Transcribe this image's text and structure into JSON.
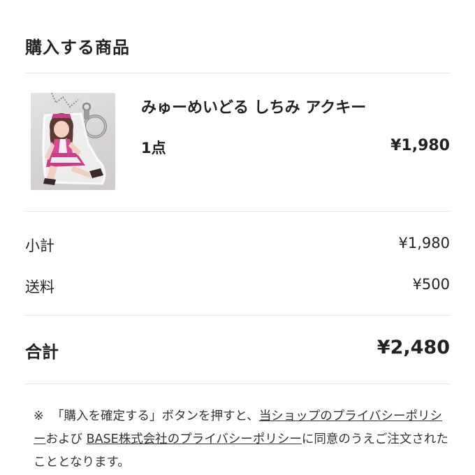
{
  "section": {
    "title": "購入する商品"
  },
  "item": {
    "name": "みゅーめいどる しちみ アクキー",
    "quantity": "1点",
    "price": "¥1,980"
  },
  "summary": {
    "subtotal_label": "小計",
    "subtotal_value": "¥1,980",
    "shipping_label": "送料",
    "shipping_value": "¥500",
    "total_label": "合計",
    "total_value": "¥2,480"
  },
  "notice": {
    "mark": "※",
    "text_1": "「購入を確定する」ボタンを押すと、",
    "link_shop_privacy": "当ショップのプライバシーポリシー",
    "text_2": "および ",
    "link_base_privacy": "BASE株式会社のプライバシーポリシー",
    "text_3": "に同意のうえご注文されたこととなります。"
  }
}
